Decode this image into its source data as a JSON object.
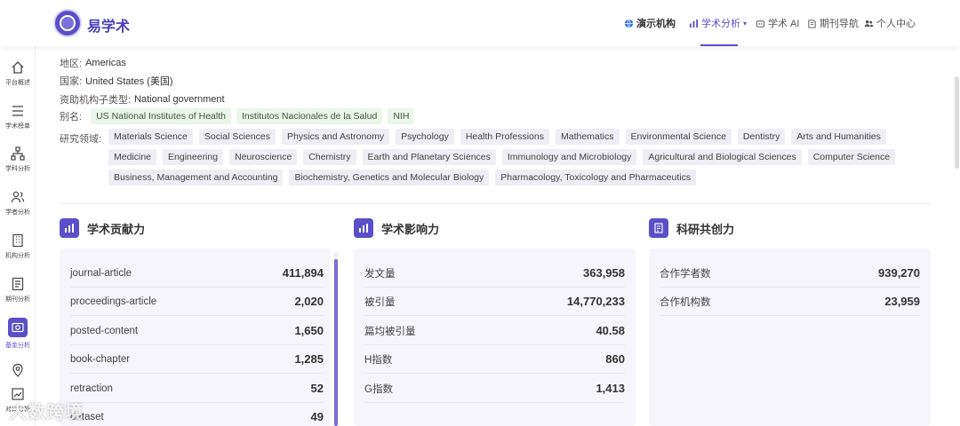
{
  "app": {
    "name": "易学术"
  },
  "nav": {
    "items": [
      {
        "label": "演示机构"
      },
      {
        "label": "学术分析"
      },
      {
        "label": "学术 AI"
      },
      {
        "label": "期刊导航"
      },
      {
        "label": "个人中心"
      }
    ]
  },
  "sidebar": {
    "items": [
      {
        "label": "平台概述",
        "icon": "home-icon"
      },
      {
        "label": "学术榜单",
        "icon": "list-icon"
      },
      {
        "label": "学科分析",
        "icon": "tree-icon"
      },
      {
        "label": "学者分析",
        "icon": "users-icon"
      },
      {
        "label": "机构分析",
        "icon": "building-icon"
      },
      {
        "label": "期刊分析",
        "icon": "journal-icon"
      },
      {
        "label": "基金分析",
        "icon": "fund-icon",
        "active": true
      },
      {
        "label": "",
        "icon": "location-icon"
      },
      {
        "label": "对比分析",
        "icon": "compare-icon"
      }
    ]
  },
  "info": {
    "region_label": "地区:",
    "region": "Americas",
    "country_label": "国家:",
    "country": "United States (美国)",
    "subtype_label": "资助机构子类型:",
    "subtype": "National government",
    "alias_label": "别名:",
    "aliases": [
      "US National Institutes of Health",
      "Institutos Nacionales de la Salud",
      "NIH"
    ],
    "fields_label": "研究领域:",
    "fields": [
      "Materials Science",
      "Social Sciences",
      "Physics and Astronomy",
      "Psychology",
      "Health Professions",
      "Mathematics",
      "Environmental Science",
      "Dentistry",
      "Arts and Humanities",
      "Medicine",
      "Engineering",
      "Neuroscience",
      "Chemistry",
      "Earth and Planetary Sciences",
      "Immunology and Microbiology",
      "Agricultural and Biological Sciences",
      "Computer Science",
      "Business, Management and Accounting",
      "Biochemistry, Genetics and Molecular Biology",
      "Pharmacology, Toxicology and Pharmaceutics"
    ]
  },
  "cards": {
    "contribution": {
      "title": "学术贡献力",
      "rows": [
        {
          "label": "journal-article",
          "value": "411,894"
        },
        {
          "label": "proceedings-article",
          "value": "2,020"
        },
        {
          "label": "posted-content",
          "value": "1,650"
        },
        {
          "label": "book-chapter",
          "value": "1,285"
        },
        {
          "label": "retraction",
          "value": "52"
        },
        {
          "label": "dataset",
          "value": "49"
        }
      ]
    },
    "influence": {
      "title": "学术影响力",
      "rows": [
        {
          "label": "发文量",
          "value": "363,958"
        },
        {
          "label": "被引量",
          "value": "14,770,233"
        },
        {
          "label": "篇均被引量",
          "value": "40.58"
        },
        {
          "label": "H指数",
          "value": "860"
        },
        {
          "label": "G指数",
          "value": "1,413"
        }
      ]
    },
    "collaboration": {
      "title": "科研共创力",
      "rows": [
        {
          "label": "合作学者数",
          "value": "939,270"
        },
        {
          "label": "合作机构数",
          "value": "23,959"
        }
      ]
    }
  },
  "watermark": "大数跨境",
  "colors": {
    "accent": "#5b4fc8",
    "tag_green_bg": "#eaf6ea",
    "tag_grey_bg": "#eeeef4"
  }
}
